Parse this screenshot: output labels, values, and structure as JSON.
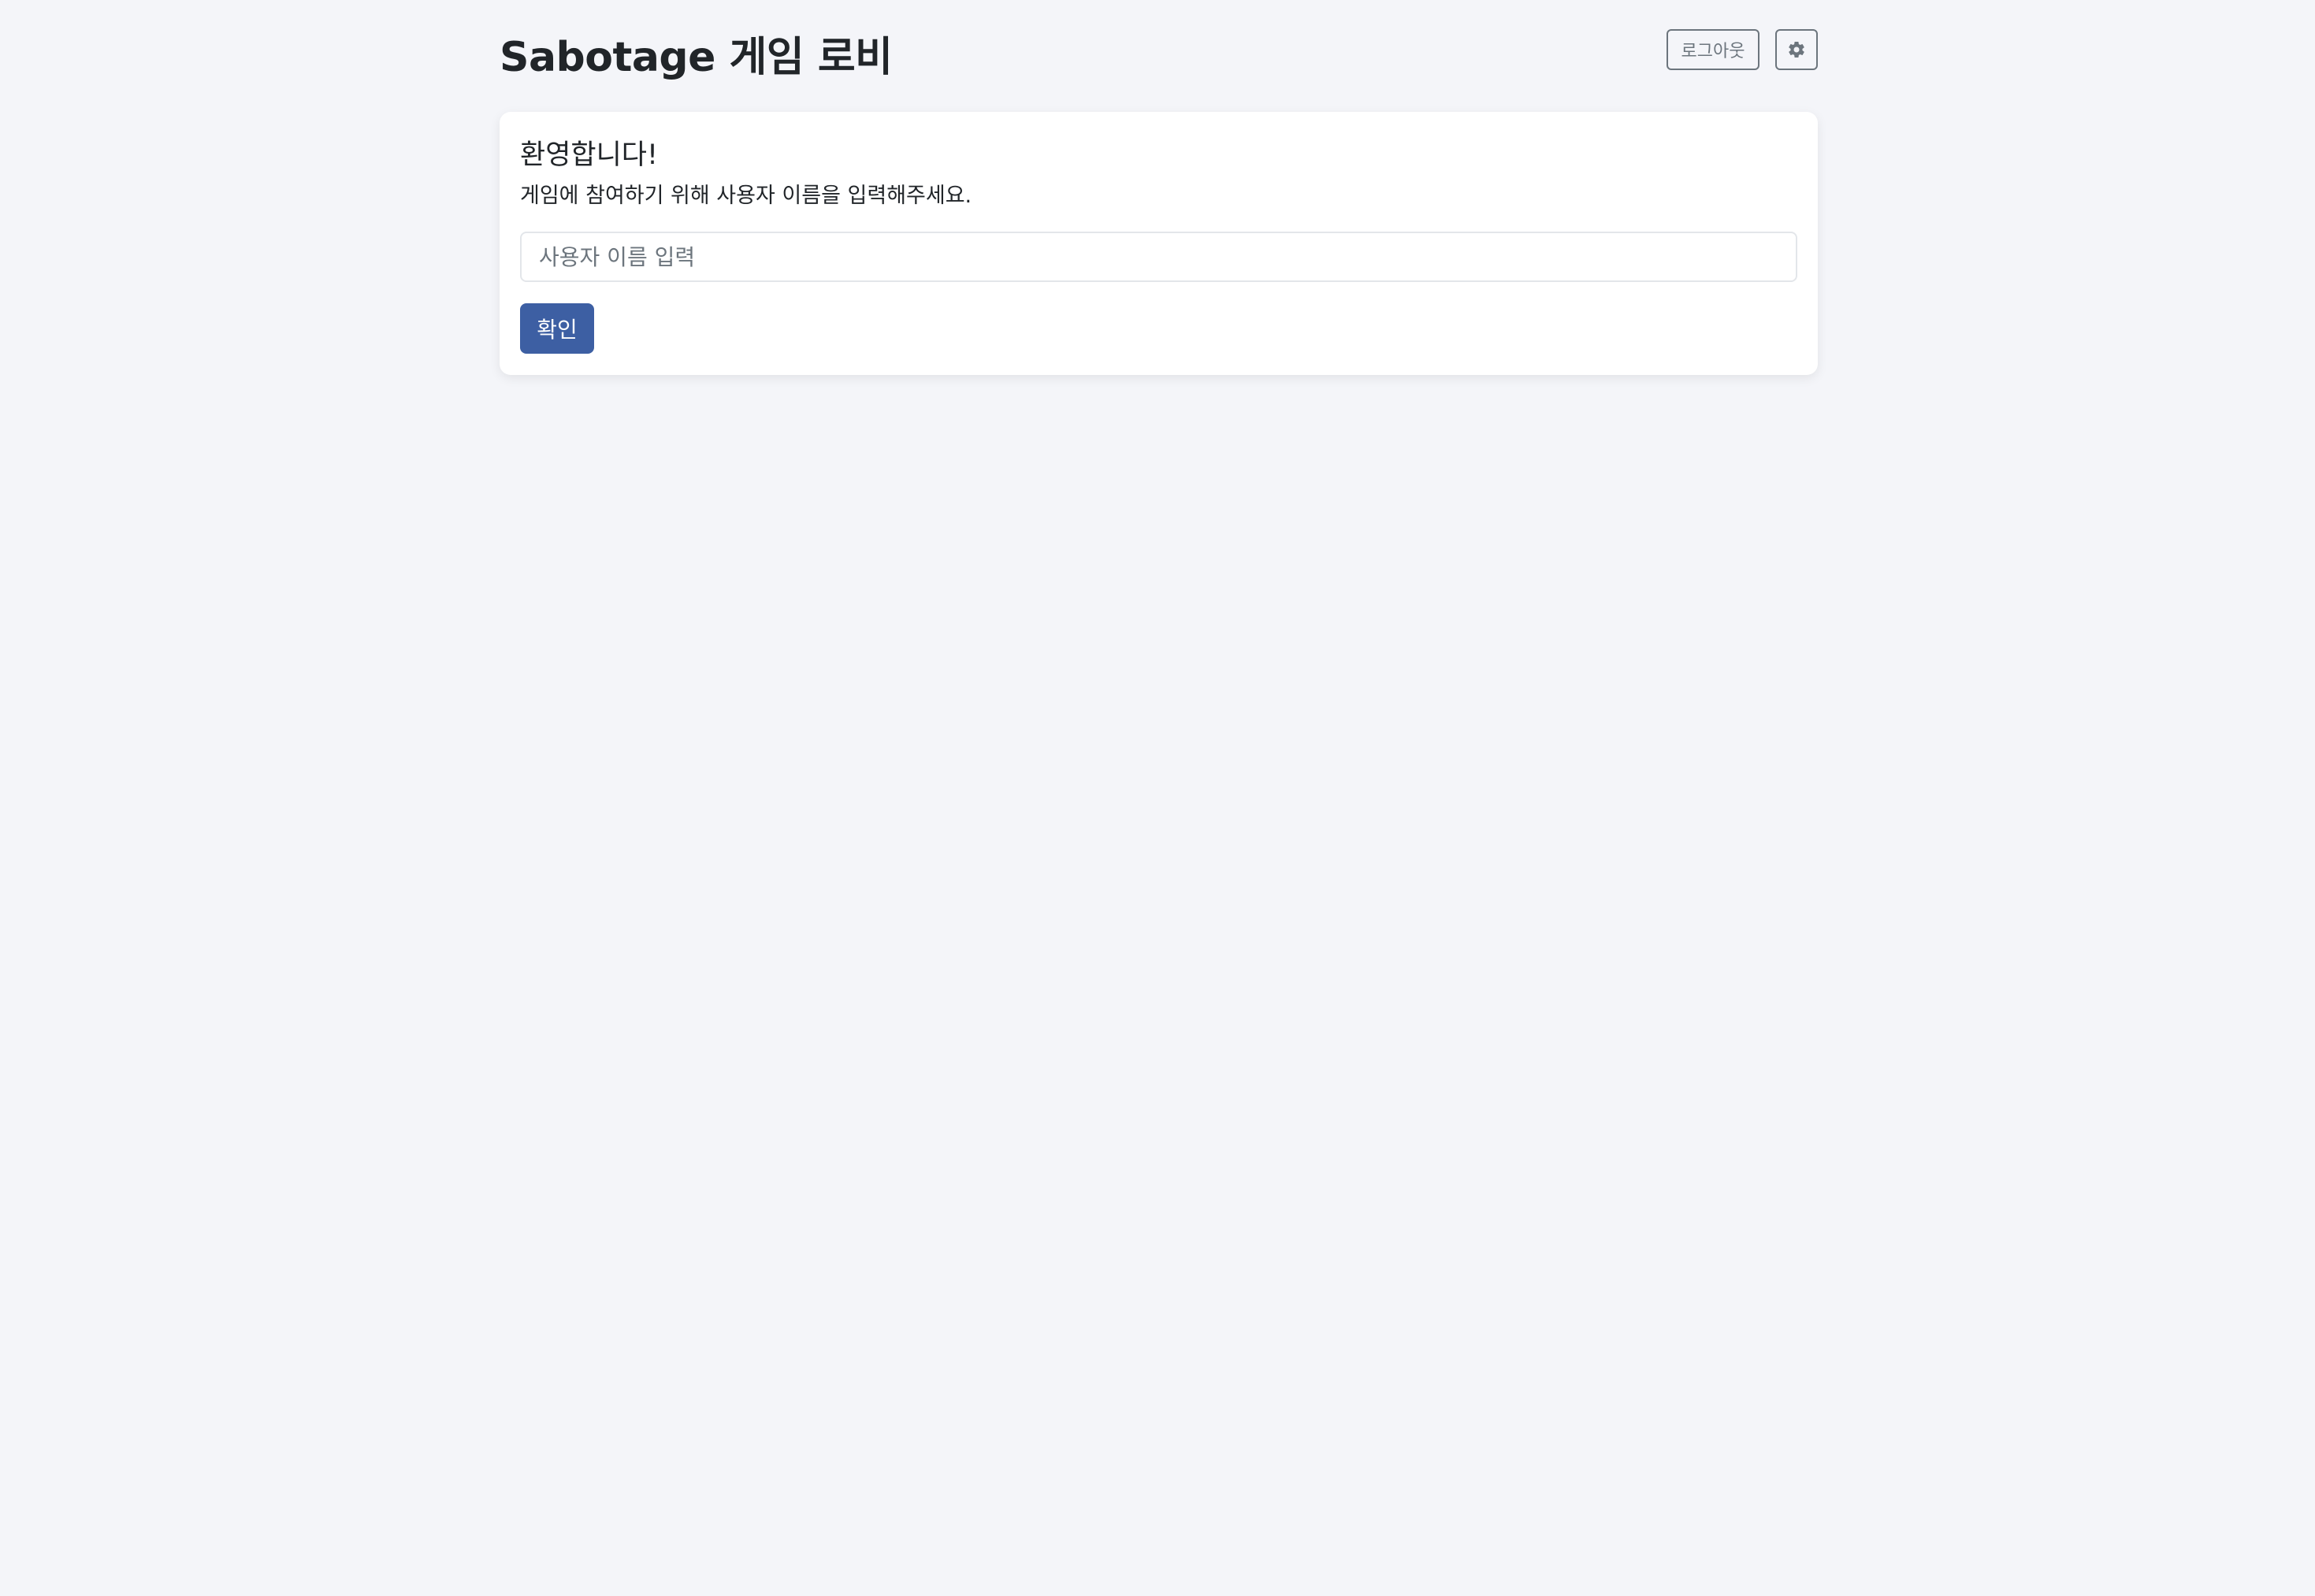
{
  "header": {
    "title": "Sabotage 게임 로비",
    "logout_label": "로그아웃",
    "settings_icon": "gear-icon"
  },
  "welcome_card": {
    "title": "환영합니다!",
    "description": "게임에 참여하기 위해 사용자 이름을 입력해주세요.",
    "username_input": {
      "placeholder": "사용자 이름 입력",
      "value": ""
    },
    "confirm_label": "확인"
  },
  "colors": {
    "background": "#f4f5f9",
    "primary_button": "#3d5fa3",
    "secondary_outline": "#6c757d"
  }
}
